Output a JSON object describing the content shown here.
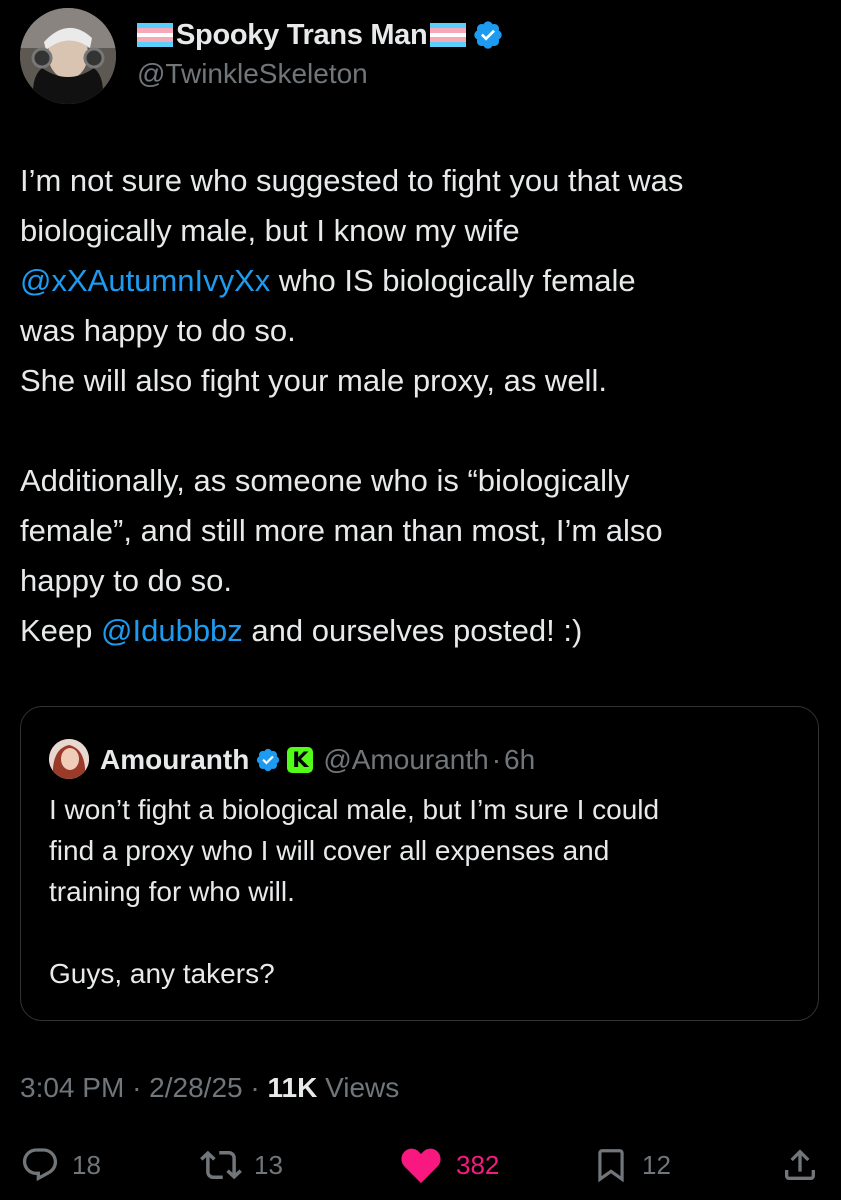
{
  "author": {
    "display_name": "Spooky Trans Man",
    "handle": "@TwinkleSkeleton",
    "avatar_icon": "avatar-photo",
    "flag_colors": [
      "#5bcefa",
      "#f5a9b8",
      "#ffffff",
      "#f5a9b8",
      "#5bcefa"
    ],
    "verified_color": "#1d9bf0"
  },
  "tweet": {
    "paragraph1": [
      {
        "text": "I’m not sure who suggested to fight you that was"
      },
      {
        "text": "biologically male, but I know my wife"
      },
      {
        "mention": "@xXAutumnIvyXx",
        "text": " who IS biologically female"
      },
      {
        "text": "was happy to do so."
      },
      {
        "text": "She will also fight your male proxy, as well."
      }
    ],
    "paragraph2": [
      {
        "text": "Additionally, as someone who is “biologically"
      },
      {
        "text": "female”, and still more man than most, I’m also"
      },
      {
        "text": "happy to do so."
      },
      {
        "prefix": "Keep ",
        "mention": "@Idubbbz",
        "text": " and ourselves posted! :)"
      }
    ]
  },
  "quote": {
    "display_name": "Amouranth",
    "handle": "@Amouranth",
    "separator": "·",
    "time": "6h",
    "badge_label": "K",
    "lines": [
      "I won’t fight a biological male, but I’m sure I could",
      "find a proxy who I will cover all expenses and",
      "training for who will.",
      "",
      "Guys, any takers?"
    ]
  },
  "meta": {
    "time": "3:04 PM",
    "sep": "·",
    "date": "2/28/25",
    "views_count": "11K",
    "views_label": "Views"
  },
  "actions": {
    "replies": "18",
    "reposts": "13",
    "likes": "382",
    "bookmarks": "12",
    "like_color": "#f91880",
    "icon_color": "#71767b"
  }
}
